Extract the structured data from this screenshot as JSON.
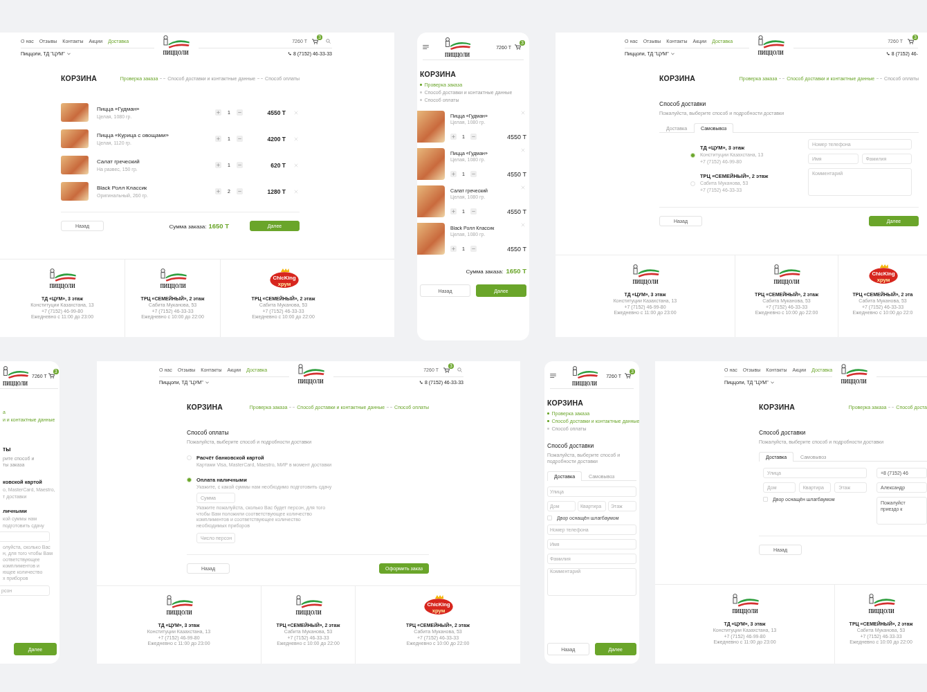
{
  "screens": [
    {
      "kind": "desktop",
      "header": {
        "nav": [
          {
            "label": "О нас",
            "selected": false
          },
          {
            "label": "Отзывы",
            "selected": false
          },
          {
            "label": "Контакты",
            "selected": false
          },
          {
            "label": "Акции",
            "selected": false
          },
          {
            "label": "Доставка",
            "selected": true
          }
        ],
        "city": "Пиццоли, ТД \"ЦУМ\"",
        "logo": {
          "kind": "pizzoli",
          "text": "ПИЦЦОЛИ"
        },
        "total": "7260 Т",
        "cart_count": "3",
        "phone": "8 (7152) 46-33-33"
      },
      "title": "КОРЗИНА",
      "steps": [
        {
          "label": "Проверка заказа",
          "done": true
        },
        {
          "label": "Способ доставки и контактные данные",
          "done": false
        },
        {
          "label": "Способ оплаты",
          "done": false
        }
      ],
      "body": {
        "kind": "cart",
        "items": [
          {
            "name": "Пицца «Гудман»",
            "note": "Целая, 1080 гр.",
            "qty": "1",
            "price": "4550 Т"
          },
          {
            "name": "Пицца «Курица с овощами»",
            "note": "Целая, 1120 гр.",
            "qty": "1",
            "price": "4200 Т"
          },
          {
            "name": "Салат греческий",
            "note": "На развес, 150 гр.",
            "qty": "1",
            "price": "620 Т"
          },
          {
            "name": "Black Ролл Классик",
            "note": "Оригинальный, 260 гр.",
            "qty": "2",
            "price": "1280 Т"
          }
        ],
        "total_label": "Сумма заказа:",
        "total": "1650 Т"
      },
      "buttons": [
        {
          "label": "Назад",
          "kind": "secondary"
        },
        {
          "label": "Далее",
          "kind": "primary"
        }
      ],
      "stores": [
        {
          "logo": {
            "kind": "pizzoli",
            "text": "ПИЦЦОЛИ"
          },
          "name": "ТД «ЦУМ», 3 этаж",
          "lines": [
            "Конституции Казахстана, 13",
            "+7 (7152) 46-99-80",
            "Ежедневно с 11:00 до 23:00"
          ]
        },
        {
          "logo": {
            "kind": "pizzoli",
            "text": "ПИЦЦОЛИ"
          },
          "name": "ТРЦ «СЕМЕЙНЫЙ», 2 этаж",
          "lines": [
            "Сабита Муканова, 53",
            "+7 (7152) 46-33-33",
            "Ежедневно с 10:00 до 22:00"
          ]
        },
        {
          "logo": {
            "kind": "chicking",
            "text": "ChicKing",
            "subtext": "хрум"
          },
          "name": "ТРЦ «СЕМЕЙНЫЙ», 2 этаж",
          "lines": [
            "Сабита Муканова, 53",
            "+7 (7152) 46-33-33",
            "Ежедневно с 10:00 до 22:00"
          ]
        }
      ]
    },
    {
      "kind": "mobile",
      "header": {
        "logo": {
          "kind": "pizzoli",
          "text": "ПИЦЦОЛИ"
        },
        "total": "7260 Т",
        "cart_count": "3"
      },
      "title": "КОРЗИНА",
      "steps": [
        {
          "label": "Проверка заказа",
          "done": true
        },
        {
          "label": "Способ доставки и контактные данные",
          "done": false
        },
        {
          "label": "Способ оплаты",
          "done": false
        }
      ],
      "body": {
        "kind": "cart",
        "items": [
          {
            "name": "Пицца «Гудман»",
            "note": "Целая, 1080 гр.",
            "qty": "1",
            "price": "4550 Т"
          },
          {
            "name": "Пицца «Гудман»",
            "note": "Целая, 1080 гр.",
            "qty": "1",
            "price": "4550 Т"
          },
          {
            "name": "Салат греческий",
            "note": "Целая, 1080 гр.",
            "qty": "1",
            "price": "4550 Т"
          },
          {
            "name": "Black Ролл Классик",
            "note": "Целая, 1080 гр.",
            "qty": "1",
            "price": "4550 Т"
          }
        ],
        "total_label": "Сумма заказа:",
        "total": "1650 Т"
      },
      "buttons": [
        {
          "label": "Назад",
          "kind": "secondary"
        },
        {
          "label": "Далее",
          "kind": "primary"
        }
      ]
    },
    {
      "kind": "desktop",
      "header": {
        "nav": [
          {
            "label": "О нас",
            "selected": false
          },
          {
            "label": "Отзывы",
            "selected": false
          },
          {
            "label": "Контакты",
            "selected": false
          },
          {
            "label": "Акции",
            "selected": false
          },
          {
            "label": "Доставка",
            "selected": true
          }
        ],
        "city": "Пиццоли, ТД \"ЦУМ\"",
        "logo": {
          "kind": "pizzoli",
          "text": "ПИЦЦОЛИ"
        },
        "total": "7260 Т",
        "cart_count": "3",
        "phone": "8 (7152) 46-"
      },
      "title": "КОРЗИНА",
      "steps": [
        {
          "label": "Проверка заказа",
          "done": true
        },
        {
          "label": "Способ доставки и контактные данные",
          "done": true
        },
        {
          "label": "Способ оплаты",
          "done": false
        }
      ],
      "body": {
        "kind": "delivery",
        "heading": "Способ доставки",
        "description": [
          "Пожалуйста, выберите способ и подробности доставки"
        ],
        "tabs": [
          {
            "label": "Доставка",
            "selected": false
          },
          {
            "label": "Самовывоз",
            "selected": true
          }
        ],
        "columns": [
          {
            "items": [
              {
                "kind": "radio",
                "title": "ТД «ЦУМ», 3 этаж",
                "lines": [
                  "Конституции Казахстана, 13",
                  "+7 (7152) 46-99-80"
                ],
                "selected": true
              },
              {
                "kind": "radio",
                "title": "ТРЦ «СЕМЕЙНЫЙ», 2 этаж",
                "lines": [
                  "Сабита Муканова, 53",
                  "+7 (7152) 46-33-33"
                ],
                "selected": false
              }
            ]
          },
          {
            "items": [
              {
                "kind": "fields",
                "fields": [
                  {
                    "kind": "input",
                    "placeholder": "Номер телефона"
                  }
                ]
              },
              {
                "kind": "fields",
                "fields": [
                  {
                    "kind": "input",
                    "placeholder": "Имя"
                  },
                  {
                    "kind": "input",
                    "placeholder": "Фамилия"
                  }
                ]
              },
              {
                "kind": "fields",
                "fields": [
                  {
                    "kind": "textarea",
                    "placeholder": "Комментарий"
                  }
                ]
              }
            ]
          }
        ]
      },
      "buttons": [
        {
          "label": "Назад",
          "kind": "secondary"
        },
        {
          "label": "Далее",
          "kind": "primary"
        }
      ],
      "stores": [
        {
          "logo": {
            "kind": "pizzoli",
            "text": "ПИЦЦОЛИ"
          },
          "name": "ТД «ЦУМ», 3 этаж",
          "lines": [
            "Конституции Казахстана, 13",
            "+7 (7152) 46-99-80",
            "Ежедневно с 11:00 до 23:00"
          ]
        },
        {
          "logo": {
            "kind": "pizzoli",
            "text": "ПИЦЦОЛИ"
          },
          "name": "ТРЦ «СЕМЕЙНЫЙ», 2 этаж",
          "lines": [
            "Сабита Муканова, 53",
            "+7 (7152) 46-33-33",
            "Ежедневно с 10:00 до 22:00"
          ]
        },
        {
          "logo": {
            "kind": "chicking",
            "text": "ChicKing",
            "subtext": "хрум"
          },
          "name": "ТРЦ «СЕМЕЙНЫЙ», 2 эта",
          "lines": [
            "Сабита Муканова, 53",
            "+7 (7152) 46-33-33",
            "Ежедневно с 10:00 до 22:0"
          ]
        }
      ]
    },
    {
      "kind": "mobile",
      "header": {
        "logo": {
          "kind": "pizzoli",
          "text": "ПИЦЦОЛИ"
        },
        "total": "7260 Т",
        "cart_count": "3"
      },
      "steps": [
        {
          "label": "а",
          "done": true
        },
        {
          "label": "и и контактные данные",
          "done": true
        }
      ],
      "body": {
        "kind": "payment",
        "heading": "ты",
        "description": [
          "рите способ и",
          "ты заказа"
        ],
        "items": [
          {
            "kind": "radio",
            "title": "ковской картой",
            "lines": [
              "о, MasterCard, Maestro,",
              "т доставки"
            ]
          },
          {
            "kind": "radio",
            "title": "личными",
            "lines": [
              "кой суммы нам",
              "подготовить сдачу"
            ],
            "details": [
              {
                "kind": "fields",
                "fields": [
                  {
                    "kind": "input"
                  }
                ]
              },
              {
                "kind": "note",
                "lines": [
                  "олуйста, сколько Вас",
                  "н, для того чтобы Вам",
                  "оответствующее",
                  "комплиментов и",
                  "ющее количество",
                  "х приборов"
                ]
              },
              {
                "kind": "fields",
                "fields": [
                  {
                    "kind": "input",
                    "placeholder": "рсон"
                  }
                ]
              }
            ]
          }
        ]
      },
      "buttons": [
        {
          "label": "Далее",
          "kind": "primary"
        }
      ]
    },
    {
      "kind": "desktop",
      "header": {
        "nav": [
          {
            "label": "О нас",
            "selected": false
          },
          {
            "label": "Отзывы",
            "selected": false
          },
          {
            "label": "Контакты",
            "selected": false
          },
          {
            "label": "Акции",
            "selected": false
          },
          {
            "label": "Доставка",
            "selected": true
          }
        ],
        "city": "Пиццоли, ТД \"ЦУМ\"",
        "logo": {
          "kind": "pizzoli",
          "text": "ПИЦЦОЛИ"
        },
        "total": "7260 Т",
        "cart_count": "3",
        "phone": "8 (7152) 46-33-33"
      },
      "title": "КОРЗИНА",
      "steps": [
        {
          "label": "Проверка заказа",
          "done": true
        },
        {
          "label": "Способ доставки и контактные данные",
          "done": true
        },
        {
          "label": "Способ оплаты",
          "done": true
        }
      ],
      "body": {
        "kind": "payment",
        "heading": "Способ оплаты",
        "description": [
          "Пожалуйста, выберите способ и подробности доставки"
        ],
        "items": [
          {
            "kind": "radio",
            "title": "Расчёт банковской картой",
            "lines": [
              "Картами Visa, MasterCard, Maestro, МИР в момент доставки"
            ],
            "selected": false
          },
          {
            "kind": "radio",
            "title": "Оплата наличными",
            "lines": [
              "Укажите, с какой суммы нам необходимо подготовить сдачу"
            ],
            "selected": true,
            "details": [
              {
                "kind": "fields",
                "fields": [
                  {
                    "kind": "input",
                    "placeholder": "Сумма"
                  }
                ]
              },
              {
                "kind": "note",
                "lines": [
                  "Укажите пожалуйста, сколько Вас будет персон, для того",
                  "чтобы Вам положили соответствующее количество",
                  "комплиментов и соответствующее количество",
                  "необходимых приборов"
                ]
              },
              {
                "kind": "fields",
                "fields": [
                  {
                    "kind": "input",
                    "placeholder": "Число персон"
                  }
                ]
              }
            ]
          }
        ]
      },
      "buttons": [
        {
          "label": "Назад",
          "kind": "secondary"
        },
        {
          "label": "Оформить заказ",
          "kind": "primary"
        }
      ],
      "stores": [
        {
          "logo": {
            "kind": "pizzoli",
            "text": "ПИЦЦОЛИ"
          },
          "name": "ТД «ЦУМ», 3 этаж",
          "lines": [
            "Конституции Казахстана, 13",
            "+7 (7152) 46-99-80",
            "Ежедневно с 11:00 до 23:00"
          ]
        },
        {
          "logo": {
            "kind": "pizzoli",
            "text": "ПИЦЦОЛИ"
          },
          "name": "ТРЦ «СЕМЕЙНЫЙ», 2 этаж",
          "lines": [
            "Сабита Муканова, 53",
            "+7 (7152) 46-33-33",
            "Ежедневно с 10:00 до 22:00"
          ]
        },
        {
          "logo": {
            "kind": "chicking",
            "text": "ChicKing",
            "subtext": "хрум"
          },
          "name": "ТРЦ «СЕМЕЙНЫЙ», 2 этаж",
          "lines": [
            "Сабита Муканова, 53",
            "+7 (7152) 46-33-33",
            "Ежедневно с 10:00 до 22:00"
          ]
        }
      ]
    },
    {
      "kind": "mobile",
      "header": {
        "logo": {
          "kind": "pizzoli",
          "text": "ПИЦЦОЛИ"
        },
        "total": "7260 Т",
        "cart_count": "3"
      },
      "title": "КОРЗИНА",
      "steps": [
        {
          "label": "Проверка заказа",
          "done": true
        },
        {
          "label": "Способ доставки и контактные данные",
          "done": true
        },
        {
          "label": "Способ оплаты",
          "done": false
        }
      ],
      "body": {
        "kind": "delivery",
        "heading": "Способ доставки",
        "description": [
          "Пожалуйста, выберите способ и",
          "подробности доставки"
        ],
        "tabs": [
          {
            "label": "Доставка",
            "selected": true
          },
          {
            "label": "Самовывоз",
            "selected": false
          }
        ],
        "columns": [
          {
            "items": [
              {
                "kind": "fields",
                "fields": [
                  {
                    "kind": "input",
                    "placeholder": "Улица"
                  }
                ]
              },
              {
                "kind": "fields",
                "fields": [
                  {
                    "kind": "input",
                    "placeholder": "Дом"
                  },
                  {
                    "kind": "input",
                    "placeholder": "Квартира"
                  },
                  {
                    "kind": "input",
                    "placeholder": "Этаж"
                  }
                ]
              },
              {
                "kind": "checkbox",
                "label": "Двор оснащён шлагбаумом",
                "checked": false
              },
              {
                "kind": "fields",
                "fields": [
                  {
                    "kind": "input",
                    "placeholder": "Номер телефона"
                  }
                ]
              },
              {
                "kind": "fields",
                "fields": [
                  {
                    "kind": "input",
                    "placeholder": "Имя"
                  }
                ]
              },
              {
                "kind": "fields",
                "fields": [
                  {
                    "kind": "input",
                    "placeholder": "Фамилия"
                  }
                ]
              },
              {
                "kind": "fields",
                "fields": [
                  {
                    "kind": "textarea",
                    "placeholder": "Комментарий"
                  }
                ]
              }
            ]
          }
        ]
      },
      "buttons": [
        {
          "label": "Назад",
          "kind": "secondary"
        },
        {
          "label": "Далее",
          "kind": "primary"
        }
      ]
    },
    {
      "kind": "desktop",
      "header": {
        "nav": [
          {
            "label": "О нас",
            "selected": false
          },
          {
            "label": "Отзывы",
            "selected": false
          },
          {
            "label": "Контакты",
            "selected": false
          },
          {
            "label": "Акции",
            "selected": false
          },
          {
            "label": "Доставка",
            "selected": true
          }
        ],
        "city": "Пиццоли, ТД \"ЦУМ\"",
        "logo": {
          "kind": "pizzoli",
          "text": "ПИЦЦОЛИ"
        }
      },
      "title": "КОРЗИНА",
      "steps": [
        {
          "label": "Проверка заказа",
          "done": true
        },
        {
          "label": "Способ доста",
          "done": true
        }
      ],
      "body": {
        "kind": "delivery",
        "heading": "Способ доставки",
        "description": [
          "Пожалуйста, выберите способ и подробности доставки"
        ],
        "tabs": [
          {
            "label": "Доставка",
            "selected": true
          },
          {
            "label": "Самовывоз",
            "selected": false
          }
        ],
        "columns": [
          {
            "items": [
              {
                "kind": "fields",
                "fields": [
                  {
                    "kind": "input",
                    "placeholder": "Улица"
                  }
                ]
              },
              {
                "kind": "fields",
                "fields": [
                  {
                    "kind": "input",
                    "placeholder": "Дом"
                  },
                  {
                    "kind": "input",
                    "placeholder": "Квартира"
                  },
                  {
                    "kind": "input",
                    "placeholder": "Этаж"
                  }
                ]
              },
              {
                "kind": "checkbox",
                "label": "Двор оснащён шлагбаумом",
                "checked": false
              }
            ]
          },
          {
            "items": [
              {
                "kind": "fields",
                "fields": [
                  {
                    "kind": "input",
                    "value": "+8 (7152) 46"
                  }
                ]
              },
              {
                "kind": "fields",
                "fields": [
                  {
                    "kind": "input",
                    "value": "Александр"
                  }
                ]
              },
              {
                "kind": "fields",
                "fields": [
                  {
                    "kind": "textarea",
                    "lines": [
                      "Пожалуйст",
                      "приездо к"
                    ]
                  }
                ]
              }
            ]
          }
        ]
      },
      "buttons": [
        {
          "label": "Назад",
          "kind": "secondary"
        }
      ],
      "stores": [
        {
          "logo": {
            "kind": "pizzoli",
            "text": "ПИЦЦОЛИ"
          },
          "name": "ТД «ЦУМ», 3 этаж",
          "lines": [
            "Конституции Казахстана, 13",
            "+7 (7152) 46-99-80",
            "Ежедневно с 11:00 до 23:00"
          ]
        },
        {
          "logo": {
            "kind": "pizzoli",
            "text": "ПИЦЦОЛИ"
          },
          "name": "ТРЦ «СЕМЕЙНЫЙ», 2 этаж",
          "lines": [
            "Сабита Муканова, 53",
            "+7 (7152) 46-33-33",
            "Ежедневно с 10:00 до 22:00"
          ]
        }
      ]
    }
  ]
}
